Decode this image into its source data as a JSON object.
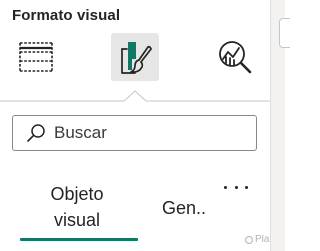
{
  "panel": {
    "title": "Formato visual",
    "tools": [
      {
        "icon": "fields-table-icon",
        "active": false
      },
      {
        "icon": "paintbrush-format-icon",
        "active": true
      },
      {
        "icon": "analytics-magnifier-icon",
        "active": false
      }
    ]
  },
  "search": {
    "placeholder": "Buscar",
    "value": ""
  },
  "tabs": {
    "visual_line1": "Objeto",
    "visual_line2": "visual",
    "general": "Gen..",
    "active": "visual"
  },
  "more_menu": {
    "icon": "more-ellipsis-icon"
  },
  "watermark": {
    "text": "Platzi"
  },
  "colors": {
    "accent": "#117865",
    "brush_green": "#117865",
    "active_tool_bg": "#e6e6e6",
    "text": "#252423"
  }
}
